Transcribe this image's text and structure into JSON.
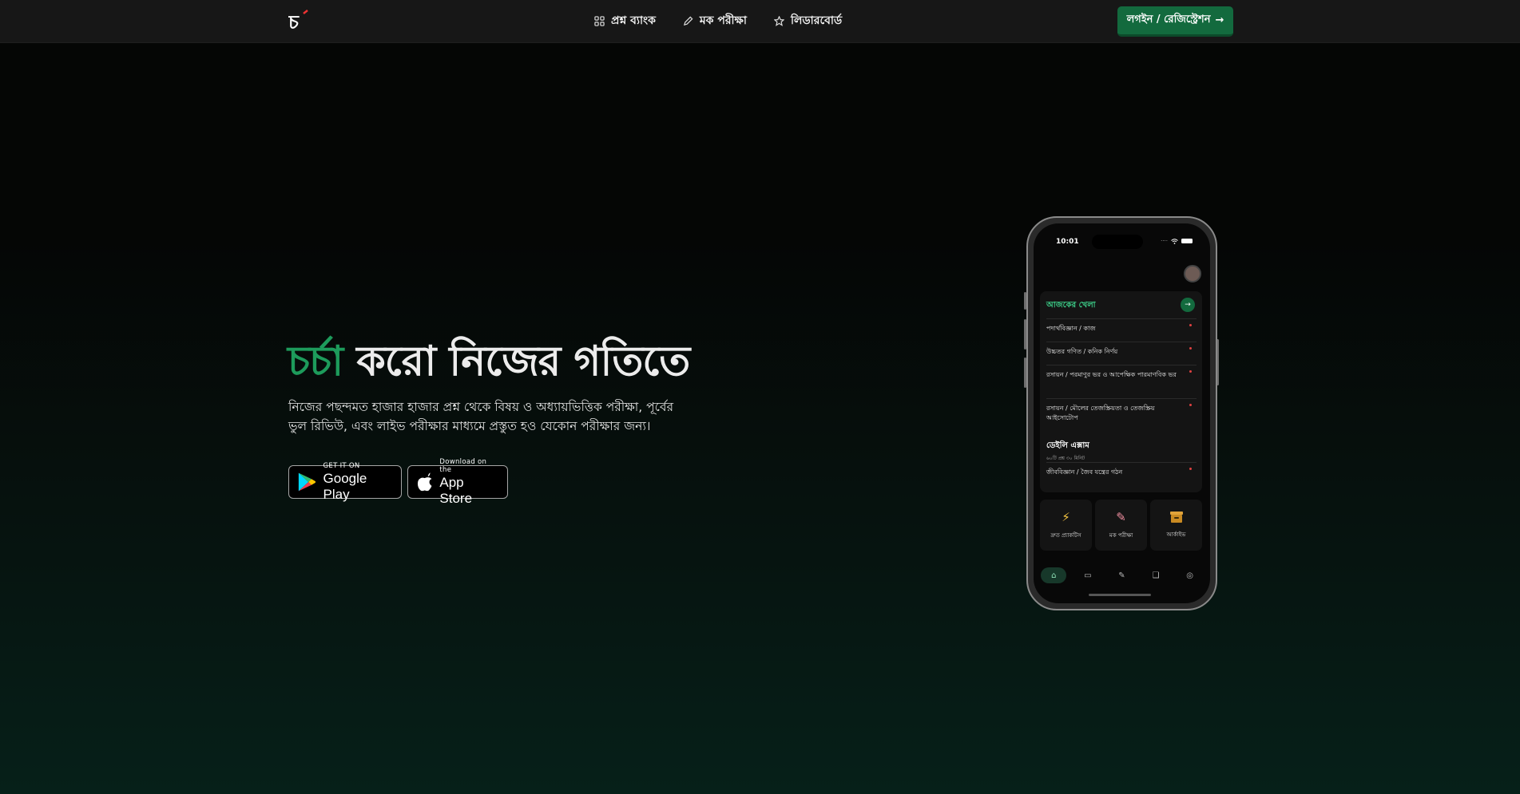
{
  "nav": {
    "logo_text": "চর্চা",
    "links": [
      {
        "label": "প্রশ্ন ব্যাংক",
        "icon": "grid-icon"
      },
      {
        "label": "মক পরীক্ষা",
        "icon": "pencil-icon"
      },
      {
        "label": "লিডারবোর্ড",
        "icon": "star-icon"
      }
    ],
    "login_label": "লগইন / রেজিস্ট্রেশন"
  },
  "hero": {
    "title_accent": "চর্চা",
    "title_rest": "করো নিজের গতিতে",
    "description": "নিজের পছন্দমত হাজার হাজার প্রশ্ন থেকে বিষয় ও অধ্যায়ভিত্তিক পরীক্ষা, পূর্বের ভুল রিভিউ, এবং লাইভ পরীক্ষার মাধ্যমে প্রস্তুত হও যেকোন পরীক্ষার জন্য।",
    "google_play": {
      "small": "GET IT ON",
      "big": "Google Play"
    },
    "app_store": {
      "small": "Download on the",
      "big": "App Store"
    }
  },
  "phone": {
    "time": "10:01",
    "panel_title": "আজকের খেলা",
    "items": [
      "পদার্থবিজ্ঞান / কাজ",
      "উচ্চতর গণিত / কনিক নির্ণয়",
      "রসায়ন / পরমাণুর ভর ও আপেক্ষিক পারমাণবিক ভর",
      "রসায়ন / মৌলের তেজস্ক্রিয়তা ও তেজস্ক্রিয় আইসোটোপ"
    ],
    "daily_title": "ডেইলি এক্সাম",
    "daily_sub": "৬০টি প্রশ্ন  ৩০ মিনিট",
    "last_item": "জীববিজ্ঞান / জৈব যন্ত্রের গঠন",
    "tiles": [
      {
        "label": "দ্রুত প্র্যাকটিস",
        "icon": "lightning-icon"
      },
      {
        "label": "মক পরীক্ষা",
        "icon": "pencil-icon"
      },
      {
        "label": "আর্কাইভ",
        "icon": "archive-icon"
      }
    ],
    "colors": {
      "accent": "#1d9b5b",
      "button": "#136a3e"
    }
  }
}
